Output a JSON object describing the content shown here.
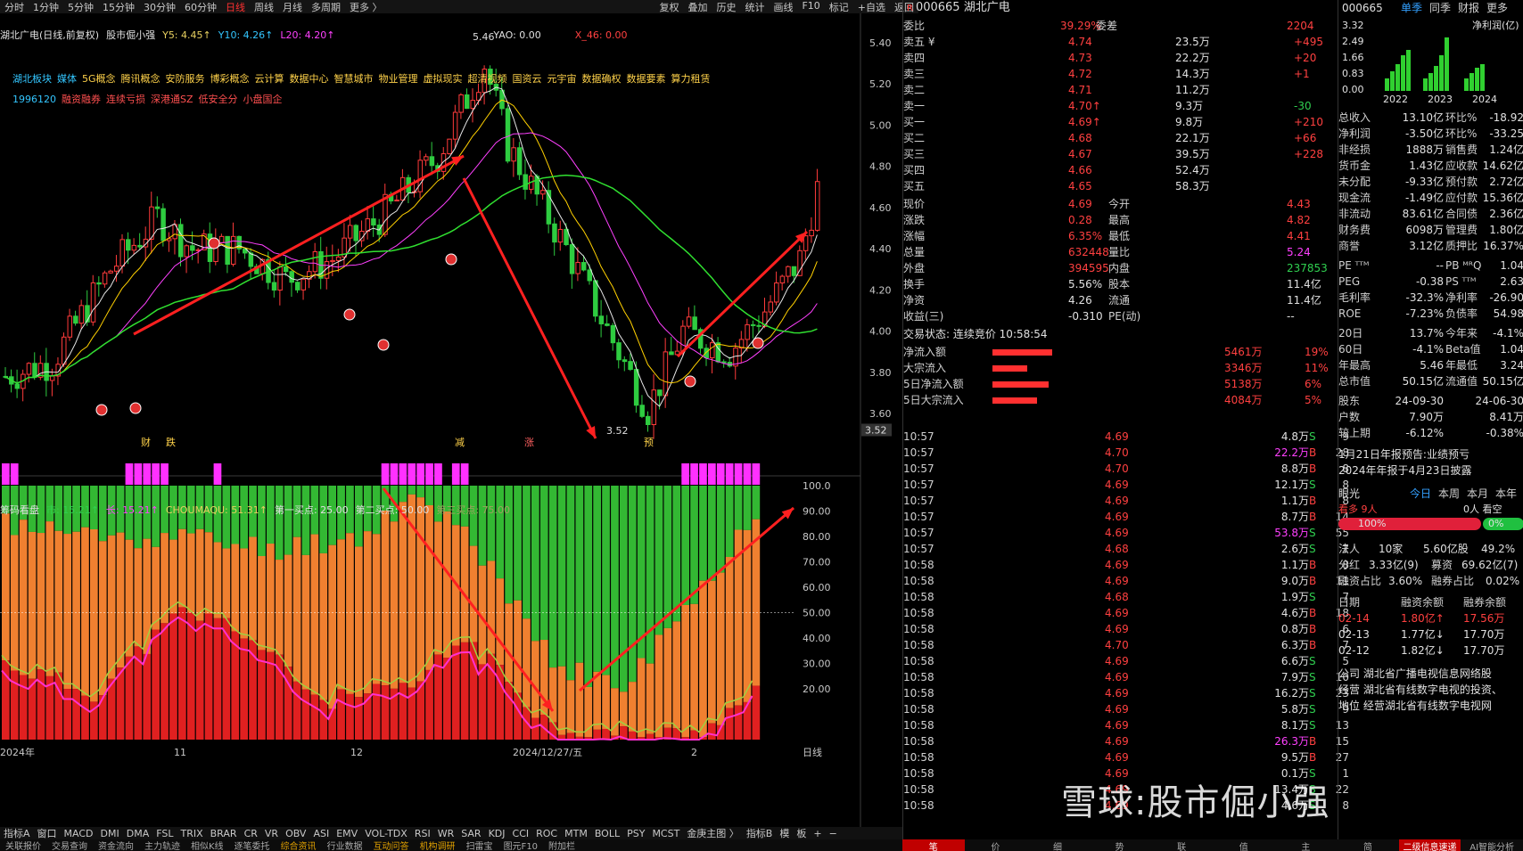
{
  "toolbar": {
    "periods": [
      "分时",
      "1分钟",
      "5分钟",
      "15分钟",
      "30分钟",
      "60分钟",
      "日线",
      "周线",
      "月线",
      "多周期",
      "更多 〉"
    ],
    "active_period": "日线",
    "tools": [
      "复权",
      "叠加",
      "历史",
      "统计",
      "画线",
      "F10",
      "标记",
      "+自选",
      "返回"
    ]
  },
  "chart_header": {
    "name": "湖北广电(日线,前复权)",
    "strategy": "股市倔小强",
    "y5": "Y5: 4.45↑",
    "y10": "Y10: 4.26↑",
    "l20": "L20: 4.20↑",
    "yao": "YAO: 0.00",
    "x46": "X_46: 0.00"
  },
  "concepts_line1": [
    "湖北板块",
    "媒体",
    "5G概念",
    "腾讯概念",
    "安防服务",
    "博彩概念",
    "云计算",
    "数据中心",
    "智慧城市",
    "物业管理",
    "虚拟现实",
    "超清视频",
    "国资云",
    "元宇宙",
    "数据确权",
    "数据要素",
    "算力租赁"
  ],
  "concepts_line2": [
    "1996120",
    "融资融券",
    "连续亏损",
    "深港通SZ",
    "低安全分",
    "小盘国企"
  ],
  "price_axis": [
    "5.40",
    "5.20",
    "5.00",
    "4.80",
    "4.60",
    "4.40",
    "4.20",
    "4.00",
    "3.80",
    "3.60"
  ],
  "price_marker": "3.52",
  "high_label": "5.46",
  "low_label": "3.52",
  "chart_labels": {
    "cai": "财",
    "die": "跌",
    "jian": "减",
    "zhang": "涨",
    "yu": "预"
  },
  "indicator_header": {
    "name": "筹码看盘",
    "shi": "市: 15.21↑",
    "chang": "长: 15.21↑",
    "choumaqu": "CHOUMAQU: 51.31↑",
    "buy1": "第一买点: 25.00",
    "buy2": "第二买点: 50.00",
    "buy3": "第三买点: 75.00"
  },
  "indicator_axis": [
    "100.0",
    "90.00",
    "80.00",
    "70.00",
    "60.00",
    "50.00",
    "40.00",
    "30.00",
    "20.00"
  ],
  "date_axis": [
    {
      "label": "2024年"
    },
    {
      "label": "11"
    },
    {
      "label": "12"
    },
    {
      "label": "2024/12/27/五"
    },
    {
      "label": "2"
    },
    {
      "label": "日线"
    }
  ],
  "bottom_tabs": [
    "指标A",
    "窗口",
    "MACD",
    "DMI",
    "DMA",
    "FSL",
    "TRIX",
    "BRAR",
    "CR",
    "VR",
    "OBV",
    "ASI",
    "EMV",
    "VOL-TDX",
    "RSI",
    "WR",
    "SAR",
    "KDJ",
    "CCI",
    "ROC",
    "MTM",
    "BOLL",
    "PSY",
    "MCST",
    "金庚主图 〉",
    "指标B",
    "模",
    "板",
    "+",
    "−"
  ],
  "bottom_tabs2": [
    "关联报价",
    "交易查询",
    "资金流向",
    "主力轨迹",
    "相似K线",
    "逐笔委托",
    "综合资讯",
    "行业数据",
    "互动问答",
    "机构调研",
    "扫雷宝",
    "图元F10",
    "附加栏"
  ],
  "quote": {
    "code": "000665",
    "name": "湖北广电",
    "weibi_label": "委比",
    "weibi": "39.29%",
    "weicha_label": "委差",
    "weicha": "2204",
    "asks": [
      {
        "label": "卖五 ¥",
        "price": "4.74",
        "vol": "23.5万",
        "chg": "+495"
      },
      {
        "label": "卖四",
        "price": "4.73",
        "vol": "22.2万",
        "chg": "+20"
      },
      {
        "label": "卖三",
        "price": "4.72",
        "vol": "14.3万",
        "chg": "+1"
      },
      {
        "label": "卖二",
        "price": "4.71",
        "vol": "11.2万",
        "chg": ""
      },
      {
        "label": "卖一",
        "price": "4.70↑",
        "vol": "9.3万",
        "chg": "-30"
      }
    ],
    "bids": [
      {
        "label": "买一",
        "price": "4.69↑",
        "vol": "9.8万",
        "chg": "+210"
      },
      {
        "label": "买二",
        "price": "4.68",
        "vol": "22.1万",
        "chg": "+66"
      },
      {
        "label": "买三",
        "price": "4.67",
        "vol": "39.5万",
        "chg": "+228"
      },
      {
        "label": "买四",
        "price": "4.66",
        "vol": "52.4万",
        "chg": ""
      },
      {
        "label": "买五",
        "price": "4.65",
        "vol": "58.3万",
        "chg": ""
      }
    ],
    "stats": [
      {
        "l1": "现价",
        "v1": "4.69",
        "l2": "今开",
        "v2": "4.43"
      },
      {
        "l1": "涨跌",
        "v1": "0.28",
        "l2": "最高",
        "v2": "4.82"
      },
      {
        "l1": "涨幅",
        "v1": "6.35%",
        "l2": "最低",
        "v2": "4.41"
      },
      {
        "l1": "总量",
        "v1": "632448",
        "l2": "量比",
        "v2": "5.24"
      },
      {
        "l1": "外盘",
        "v1": "394595",
        "l2": "内盘",
        "v2": "237853"
      },
      {
        "l1": "换手",
        "v1": "5.56%",
        "l2": "股本",
        "v2": "11.4亿"
      },
      {
        "l1": "净资",
        "v1": "4.26",
        "l2": "流通",
        "v2": "11.4亿"
      },
      {
        "l1": "收益(三)",
        "v1": "-0.310",
        "l2": "PE(动)",
        "v2": "--"
      }
    ],
    "trade_status": "交易状态: 连续竞价 10:58:54",
    "flows": [
      {
        "label": "净流入额",
        "value": "5461万",
        "pct": "19%",
        "bar": 0.95
      },
      {
        "label": "大宗流入",
        "value": "3346万",
        "pct": "11%",
        "bar": 0.55
      },
      {
        "label": "5日净流入额",
        "value": "5138万",
        "pct": "6%",
        "bar": 0.9
      },
      {
        "label": "5日大宗流入",
        "value": "4084万",
        "pct": "5%",
        "bar": 0.72
      }
    ],
    "ticks": [
      {
        "t": "10:57",
        "p": "4.69",
        "v": "4.8万",
        "s": "S",
        "n": "9"
      },
      {
        "t": "10:57",
        "p": "4.70",
        "v": "22.2万",
        "s": "B",
        "n": "28"
      },
      {
        "t": "10:57",
        "p": "4.70",
        "v": "8.8万",
        "s": "B",
        "n": "8"
      },
      {
        "t": "10:57",
        "p": "4.69",
        "v": "12.1万",
        "s": "S",
        "n": "8"
      },
      {
        "t": "10:57",
        "p": "4.69",
        "v": "1.1万",
        "s": "B",
        "n": "8"
      },
      {
        "t": "10:57",
        "p": "4.69",
        "v": "8.7万",
        "s": "B",
        "n": "14"
      },
      {
        "t": "10:57",
        "p": "4.69",
        "v": "53.8万",
        "s": "S",
        "n": "55"
      },
      {
        "t": "10:57",
        "p": "4.68",
        "v": "2.6万",
        "s": "S",
        "n": "7"
      },
      {
        "t": "10:58",
        "p": "4.69",
        "v": "1.1万",
        "s": "B",
        "n": "8"
      },
      {
        "t": "10:58",
        "p": "4.69",
        "v": "9.0万",
        "s": "B",
        "n": "11"
      },
      {
        "t": "10:58",
        "p": "4.68",
        "v": "1.9万",
        "s": "S",
        "n": "7"
      },
      {
        "t": "10:58",
        "p": "4.69",
        "v": "4.6万",
        "s": "B",
        "n": "18"
      },
      {
        "t": "10:58",
        "p": "4.69",
        "v": "0.8万",
        "s": "B",
        "n": "6"
      },
      {
        "t": "10:58",
        "p": "4.70",
        "v": "6.3万",
        "s": "B",
        "n": "7"
      },
      {
        "t": "10:58",
        "p": "4.69",
        "v": "6.6万",
        "s": "S",
        "n": "5"
      },
      {
        "t": "10:58",
        "p": "4.69",
        "v": "7.9万",
        "s": "S",
        "n": "10"
      },
      {
        "t": "10:58",
        "p": "4.69",
        "v": "16.2万",
        "s": "S",
        "n": "23"
      },
      {
        "t": "10:58",
        "p": "4.69",
        "v": "5.8万",
        "s": "S",
        "n": "9"
      },
      {
        "t": "10:58",
        "p": "4.69",
        "v": "8.1万",
        "s": "S",
        "n": "13"
      },
      {
        "t": "10:58",
        "p": "4.69",
        "v": "26.3万",
        "s": "B",
        "n": "15"
      },
      {
        "t": "10:58",
        "p": "4.69",
        "v": "9.5万",
        "s": "B",
        "n": "27"
      },
      {
        "t": "10:58",
        "p": "4.69",
        "v": "0.1万",
        "s": "S",
        "n": "1"
      },
      {
        "t": "10:58",
        "p": "4.69",
        "v": "13.4万",
        "s": "S",
        "n": "22"
      },
      {
        "t": "10:58",
        "p": "4.69",
        "v": "4.6万",
        "s": "S",
        "n": "8"
      }
    ]
  },
  "side": {
    "code": "000665",
    "tabs": [
      "单季",
      "同季",
      "财报",
      "更多"
    ],
    "mini_chart": {
      "title": "净利润(亿)",
      "y_labels": [
        "3.32",
        "2.49",
        "1.66",
        "0.83",
        "0.00"
      ],
      "x_labels": [
        "2022",
        "2023",
        "2024"
      ]
    },
    "fin": [
      {
        "l1": "总收入",
        "v1": "13.10亿",
        "l2": "环比%",
        "v2": "-18.92"
      },
      {
        "l1": "净利润",
        "v1": "-3.50亿",
        "l2": "环比%",
        "v2": "-33.25"
      },
      {
        "l1": "非经损",
        "v1": "1888万",
        "l2": "销售费",
        "v2": "1.24亿"
      },
      {
        "l1": "货币金",
        "v1": "1.43亿",
        "l2": "应收款",
        "v2": "14.62亿"
      },
      {
        "l1": "未分配",
        "v1": "-9.33亿",
        "l2": "预付款",
        "v2": "2.72亿"
      },
      {
        "l1": "现金流",
        "v1": "-1.49亿",
        "l2": "应付款",
        "v2": "15.36亿"
      },
      {
        "l1": "非流动",
        "v1": "83.61亿",
        "l2": "合同债",
        "v2": "2.36亿"
      },
      {
        "l1": "财务费",
        "v1": "6098万",
        "l2": "管理费",
        "v2": "1.80亿"
      },
      {
        "l1": "商誉",
        "v1": "3.12亿",
        "l2": "质押比",
        "v2": "16.37%"
      }
    ],
    "val": [
      {
        "l1": "PE ᵀᵀᴹ",
        "v1": "--",
        "l2": "PB ᴹᴿQ",
        "v2": "1.04"
      },
      {
        "l1": "PEG",
        "v1": "-0.38",
        "l2": "PS ᵀᵀᴹ",
        "v2": "2.63"
      },
      {
        "l1": "毛利率",
        "v1": "-32.3%",
        "l2": "净利率",
        "v2": "-26.90"
      },
      {
        "l1": "ROE",
        "v1": "-7.23%",
        "l2": "负债率",
        "v2": "54.98"
      }
    ],
    "perf": [
      {
        "l1": "20日",
        "v1": "13.7%",
        "l2": "今年来",
        "v2": "-4.1%"
      },
      {
        "l1": "60日",
        "v1": "-4.1%",
        "l2": "Beta值",
        "v2": "1.04"
      },
      {
        "l1": "年最高",
        "v1": "5.46",
        "l2": "年最低",
        "v2": "3.24"
      },
      {
        "l1": "总市值",
        "v1": "50.15亿",
        "l2": "流通值",
        "v2": "50.15亿"
      }
    ],
    "holders": [
      {
        "l1": "股东",
        "v1": "24-09-30",
        "v2": "24-06-30"
      },
      {
        "l1": "户数",
        "v1": "7.90万",
        "v2": "8.41万"
      },
      {
        "l1": "较上期",
        "v1": "-6.12%",
        "v2": "-0.38%"
      }
    ],
    "news": [
      "1月21日年报预告:业绩预亏",
      "2024年年报于4月23日披露"
    ],
    "yanguang": {
      "label": "眼光",
      "tabs": [
        "今日",
        "本周",
        "本月",
        "本年"
      ],
      "bull": "看多 9人",
      "bear": "0人 看空",
      "bull_pct": "100%",
      "bear_pct": "0%"
    },
    "legal": {
      "l1": "法人",
      "v1": "10家",
      "v2": "5.60亿股",
      "v3": "49.2%"
    },
    "fenhong": {
      "l1": "分红",
      "v1": "3.33亿(9)",
      "l2": "募资",
      "v2": "69.62亿(7)"
    },
    "margin": {
      "l1": "融资占比",
      "v1": "3.60%",
      "l2": "融券占比",
      "v2": "0.02%"
    },
    "margin_table": {
      "headers": [
        "日期",
        "融资余额",
        "融券余额"
      ],
      "rows": [
        {
          "d": "02-14",
          "a": "1.80亿↑",
          "b": "17.56万"
        },
        {
          "d": "02-13",
          "a": "1.77亿↓",
          "b": "17.70万"
        },
        {
          "d": "02-12",
          "a": "1.82亿↓",
          "b": "17.70万"
        }
      ]
    },
    "company": "公司 湖北省广播电视信息网络股",
    "ops": "经营 湖北省有线数字电视的投资、",
    "region": "地位 经营湖北省有线数字电视网"
  },
  "watermark": "雪球:股市倔小强",
  "right_bottom_tabs": [
    "笔",
    "价",
    "细",
    "势",
    "联",
    "值",
    "主",
    "简",
    "二级信息速递",
    "AI智能分析"
  ]
}
